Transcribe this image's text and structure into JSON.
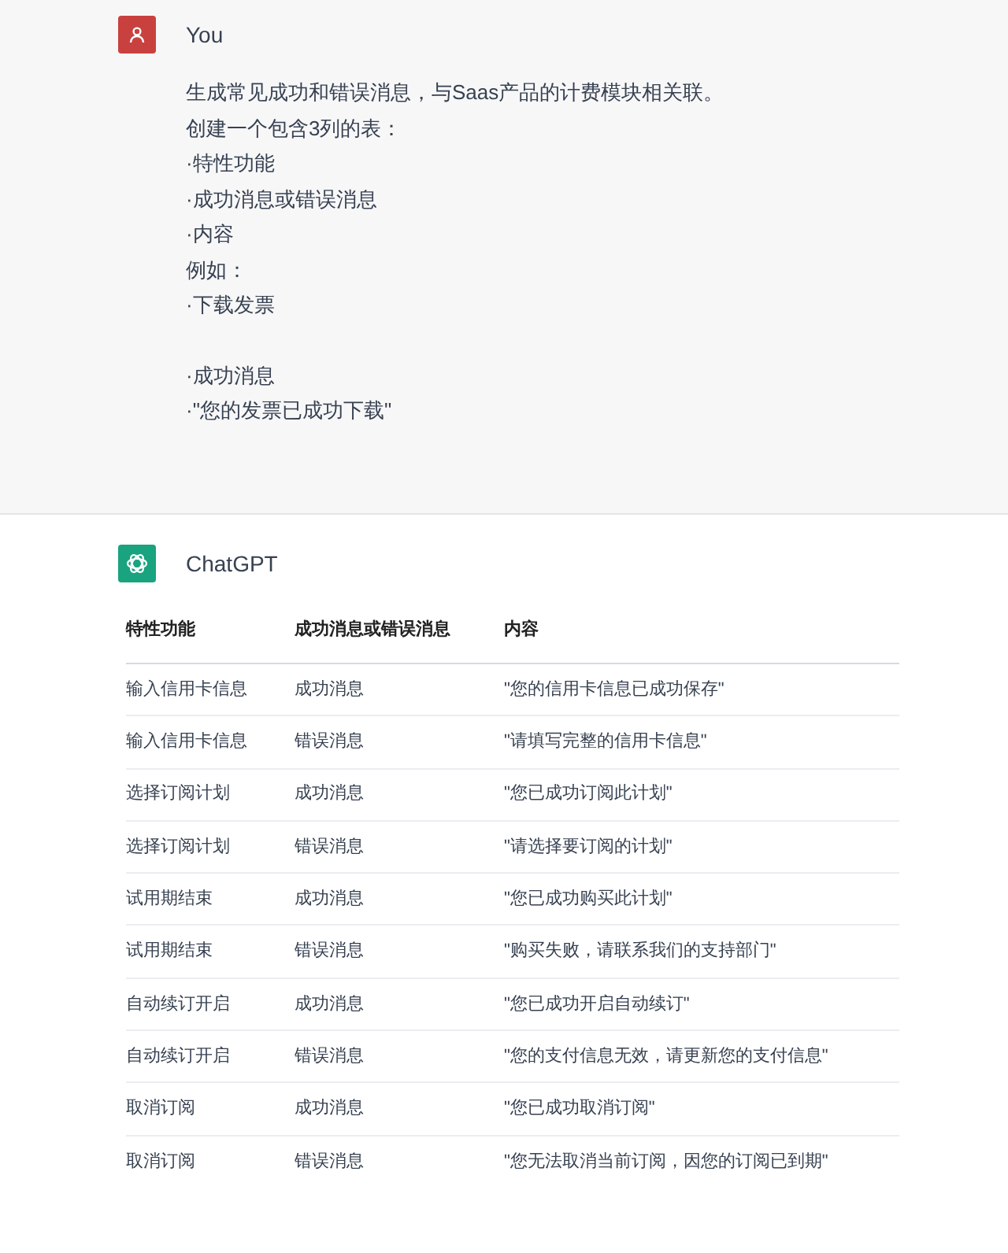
{
  "user_message": {
    "author": "You",
    "paragraphs": [
      [
        "生成常见成功和错误消息，与Saas产品的计费模块相关联。",
        "创建一个包含3列的表：",
        "·特性功能",
        "·成功消息或错误消息",
        "·内容",
        "例如：",
        "·下载发票"
      ],
      [
        "·成功消息",
        "·\"您的发票已成功下载\""
      ]
    ]
  },
  "assistant_message": {
    "author": "ChatGPT",
    "table": {
      "columns": [
        "特性功能",
        "成功消息或错误消息",
        "内容"
      ],
      "rows": [
        [
          "输入信用卡信息",
          "成功消息",
          "\"您的信用卡信息已成功保存\""
        ],
        [
          "输入信用卡信息",
          "错误消息",
          "\"请填写完整的信用卡信息\""
        ],
        [
          "选择订阅计划",
          "成功消息",
          "\"您已成功订阅此计划\""
        ],
        [
          "选择订阅计划",
          "错误消息",
          "\"请选择要订阅的计划\""
        ],
        [
          "试用期结束",
          "成功消息",
          "\"您已成功购买此计划\""
        ],
        [
          "试用期结束",
          "错误消息",
          "\"购买失败，请联系我们的支持部门\""
        ],
        [
          "自动续订开启",
          "成功消息",
          "\"您已成功开启自动续订\""
        ],
        [
          "自动续订开启",
          "错误消息",
          "\"您的支付信息无效，请更新您的支付信息\""
        ],
        [
          "取消订阅",
          "成功消息",
          "\"您已成功取消订阅\""
        ],
        [
          "取消订阅",
          "错误消息",
          "\"您无法取消当前订阅，因您的订阅已到期\""
        ]
      ]
    }
  }
}
